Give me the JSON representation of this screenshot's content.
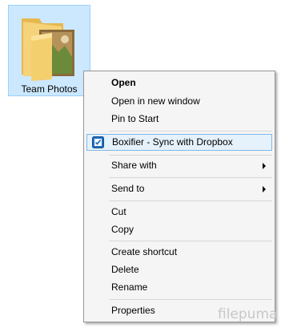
{
  "folder": {
    "name": "Team Photos"
  },
  "context_menu": {
    "items": [
      {
        "label": "Open",
        "bold": true
      },
      {
        "label": "Open in new window"
      },
      {
        "label": "Pin to Start"
      },
      {
        "label": "Boxifier - Sync with Dropbox",
        "icon": "boxifier-check-icon"
      },
      {
        "label": "Share with",
        "submenu": true
      },
      {
        "label": "Send to",
        "submenu": true
      },
      {
        "label": "Cut"
      },
      {
        "label": "Copy"
      },
      {
        "label": "Create shortcut"
      },
      {
        "label": "Delete"
      },
      {
        "label": "Rename"
      },
      {
        "label": "Properties"
      }
    ]
  },
  "watermark": "filepuma",
  "colors": {
    "selection_bg": "#cce8ff",
    "highlight_bg": "#e5f1fb",
    "highlight_border": "#7fb8e6",
    "menu_bg": "#f5f5f5"
  }
}
